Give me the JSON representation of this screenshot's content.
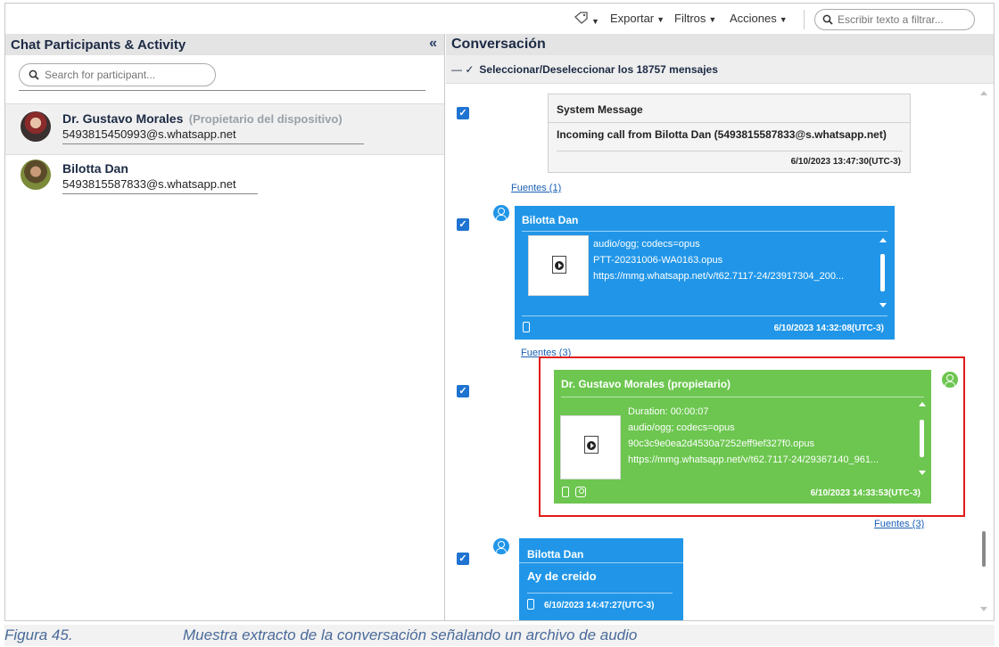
{
  "toolbar": {
    "export_label": "Exportar",
    "filters_label": "Filtros",
    "actions_label": "Acciones",
    "filter_placeholder": "Escribir texto a filtrar..."
  },
  "left_panel": {
    "title": "Chat Participants & Activity",
    "search_placeholder": "Search for participant...",
    "participants": [
      {
        "name": "Dr. Gustavo Morales",
        "role": "(Propietario del dispositivo)",
        "number": "5493815450993@s.whatsapp.net"
      },
      {
        "name": "Bilotta Dan",
        "role": "",
        "number": "5493815587833@s.whatsapp.net"
      }
    ]
  },
  "conversation": {
    "title": "Conversación",
    "select_all_label": "Seleccionar/Deseleccionar los 18757 mensajes",
    "messages": [
      {
        "sender": "System Message",
        "body": "Incoming call from Bilotta Dan (5493815587833@s.whatsapp.net)",
        "timestamp": "6/10/2023 13:47:30(UTC-3)",
        "sources": "Fuentes (1)"
      },
      {
        "sender": "Bilotta Dan",
        "mime": "audio/ogg; codecs=opus",
        "filename": "PTT-20231006-WA0163.opus",
        "url": "https://mmg.whatsapp.net/v/t62.7117-24/23917304_200...",
        "timestamp": "6/10/2023 14:32:08(UTC-3)",
        "sources": "Fuentes (3)"
      },
      {
        "sender": "Dr. Gustavo Morales (propietario)",
        "duration": "Duration: 00:00:07",
        "mime": "audio/ogg; codecs=opus",
        "filename": "90c3c9e0ea2d4530a7252eff9ef327f0.opus",
        "url": "https://mmg.whatsapp.net/v/t62.7117-24/29367140_961...",
        "timestamp": "6/10/2023 14:33:53(UTC-3)",
        "sources": "Fuentes (3)"
      },
      {
        "sender": "Bilotta Dan",
        "body": "Ay de creido",
        "timestamp": "6/10/2023 14:47:27(UTC-3)"
      }
    ]
  },
  "caption": {
    "number": "Figura 45.",
    "text": "Muestra extracto de la conversación señalando un archivo de audio"
  },
  "colors": {
    "incoming_bubble": "#2196e8",
    "outgoing_bubble": "#6cc64f",
    "highlight_border": "#e01b1b",
    "checkbox": "#1f73d1"
  }
}
